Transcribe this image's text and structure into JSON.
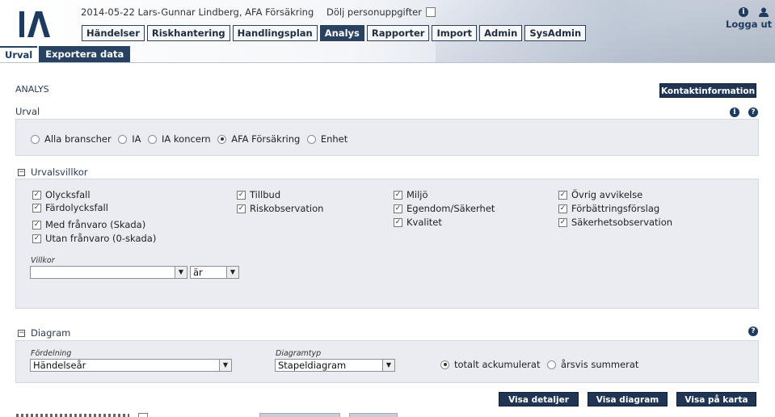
{
  "header": {
    "user_info": "2014-05-22 Lars-Gunnar Lindberg, AFA Försäkring",
    "hide_personal_label": "Dölj personuppgifter",
    "logout_label": "Logga ut",
    "info_icon": "i",
    "logo_text": "IA"
  },
  "nav": {
    "items": [
      "Händelser",
      "Riskhantering",
      "Handlingsplan",
      "Analys",
      "Rapporter",
      "Import",
      "Admin",
      "SysAdmin"
    ],
    "active": "Analys"
  },
  "subtabs": {
    "items": [
      "Urval",
      "Exportera data"
    ],
    "active": "Urval"
  },
  "page": {
    "title": "ANALYS",
    "contact_button": "Kontaktinformation"
  },
  "urval": {
    "title": "Urval",
    "options": [
      "Alla branscher",
      "IA",
      "IA koncern",
      "AFA Försäkring",
      "Enhet"
    ],
    "selected": "AFA Försäkring"
  },
  "urvalsvillkor": {
    "title": "Urvalsvillkor",
    "col1": [
      "Olycksfall",
      "Färdolycksfall",
      "Med frånvaro (Skada)",
      "Utan frånvaro (0-skada)"
    ],
    "col2": [
      "Tillbud",
      "Riskobservation"
    ],
    "col3": [
      "Miljö",
      "Egendom/Säkerhet",
      "Kvalitet"
    ],
    "col4": [
      "Övrig avvikelse",
      "Förbättringsförslag",
      "Säkerhetsobservation"
    ],
    "villkor_label": "Villkor",
    "villkor_value": "",
    "operator_value": "är"
  },
  "diagram": {
    "title": "Diagram",
    "fordelning_label": "Fördelning",
    "fordelning_value": "Händelseår",
    "diagramtyp_label": "Diagramtyp",
    "diagramtyp_value": "Stapeldiagram",
    "accum_options": [
      "totalt ackumulerat",
      "årsvis summerat"
    ],
    "accum_selected": "totalt ackumulerat"
  },
  "actions": {
    "visa_detaljer": "Visa detaljer",
    "visa_diagram": "Visa diagram",
    "visa_pa_karta": "Visa på karta"
  }
}
